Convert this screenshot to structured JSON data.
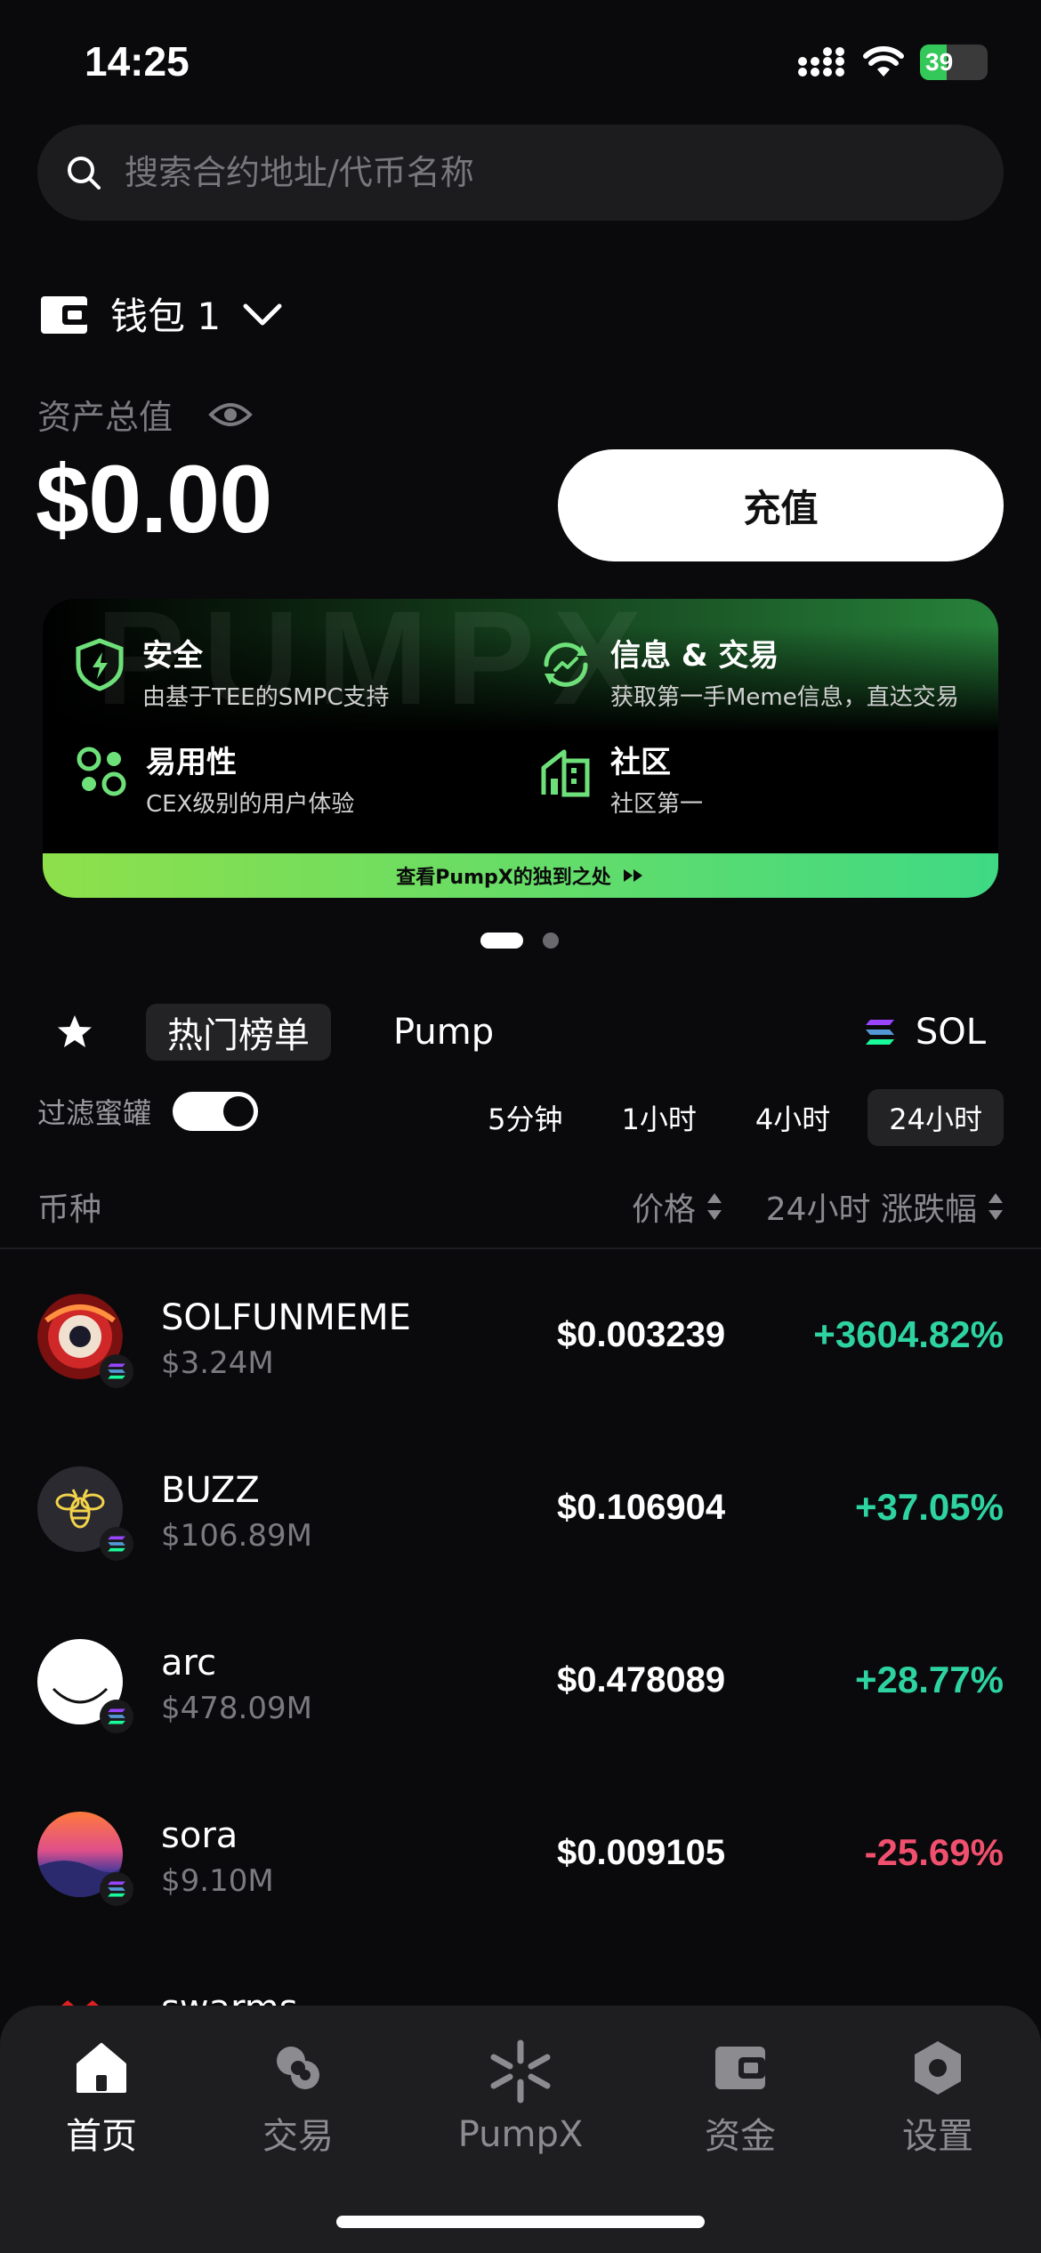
{
  "status": {
    "time": "14:25",
    "battery": "39",
    "battery_level": 0.39
  },
  "search": {
    "placeholder": "搜索合约地址/代币名称"
  },
  "wallet": {
    "name": "钱包 1"
  },
  "assets": {
    "label": "资产总值",
    "value": "$0.00",
    "deposit_label": "充值"
  },
  "banner": {
    "watermark": "PUMPX",
    "features": [
      {
        "title": "安全",
        "subtitle": "由基于TEE的SMPC支持",
        "icon": "shield-icon"
      },
      {
        "title": "信息 & 交易",
        "subtitle": "获取第一手Meme信息，直达交易",
        "icon": "refresh-trend-icon"
      },
      {
        "title": "易用性",
        "subtitle": "CEX级别的用户体验",
        "icon": "nodes-icon"
      },
      {
        "title": "社区",
        "subtitle": "社区第一",
        "icon": "house-icon"
      }
    ],
    "cta": "查看PumpX的独到之处",
    "accent_from": "#8ee04a",
    "accent_to": "#3fd984"
  },
  "tabs": {
    "hot": "热门榜单",
    "pump": "Pump",
    "chain": "SOL"
  },
  "filter": {
    "label": "过滤蜜罐",
    "enabled": true
  },
  "time_tabs": [
    "5分钟",
    "1小时",
    "4小时",
    "24小时"
  ],
  "columns": {
    "coin": "币种",
    "price": "价格",
    "change": "24小时 涨跌幅"
  },
  "tokens": [
    {
      "name": "SOLFUNMEME",
      "mcap": "$3.24M",
      "price": "$0.003239",
      "change": "+3604.82%",
      "direction": "up"
    },
    {
      "name": "BUZZ",
      "mcap": "$106.89M",
      "price": "$0.106904",
      "change": "+37.05%",
      "direction": "up"
    },
    {
      "name": "arc",
      "mcap": "$478.09M",
      "price": "$0.478089",
      "change": "+28.77%",
      "direction": "up"
    },
    {
      "name": "sora",
      "mcap": "$9.10M",
      "price": "$0.009105",
      "change": "-25.69%",
      "direction": "down"
    },
    {
      "name": "swarms",
      "mcap": "",
      "price": "",
      "change": "",
      "direction": "up"
    }
  ],
  "nav": [
    {
      "label": "首页",
      "icon": "home-icon",
      "active": true
    },
    {
      "label": "交易",
      "icon": "trade-icon",
      "active": false
    },
    {
      "label": "PumpX",
      "icon": "pumpx-icon",
      "active": false
    },
    {
      "label": "资金",
      "icon": "wallet-icon",
      "active": false
    },
    {
      "label": "设置",
      "icon": "settings-icon",
      "active": false
    }
  ],
  "colors": {
    "up": "#2ed3a2",
    "down": "#f0506e",
    "background": "#0a0a0c"
  }
}
